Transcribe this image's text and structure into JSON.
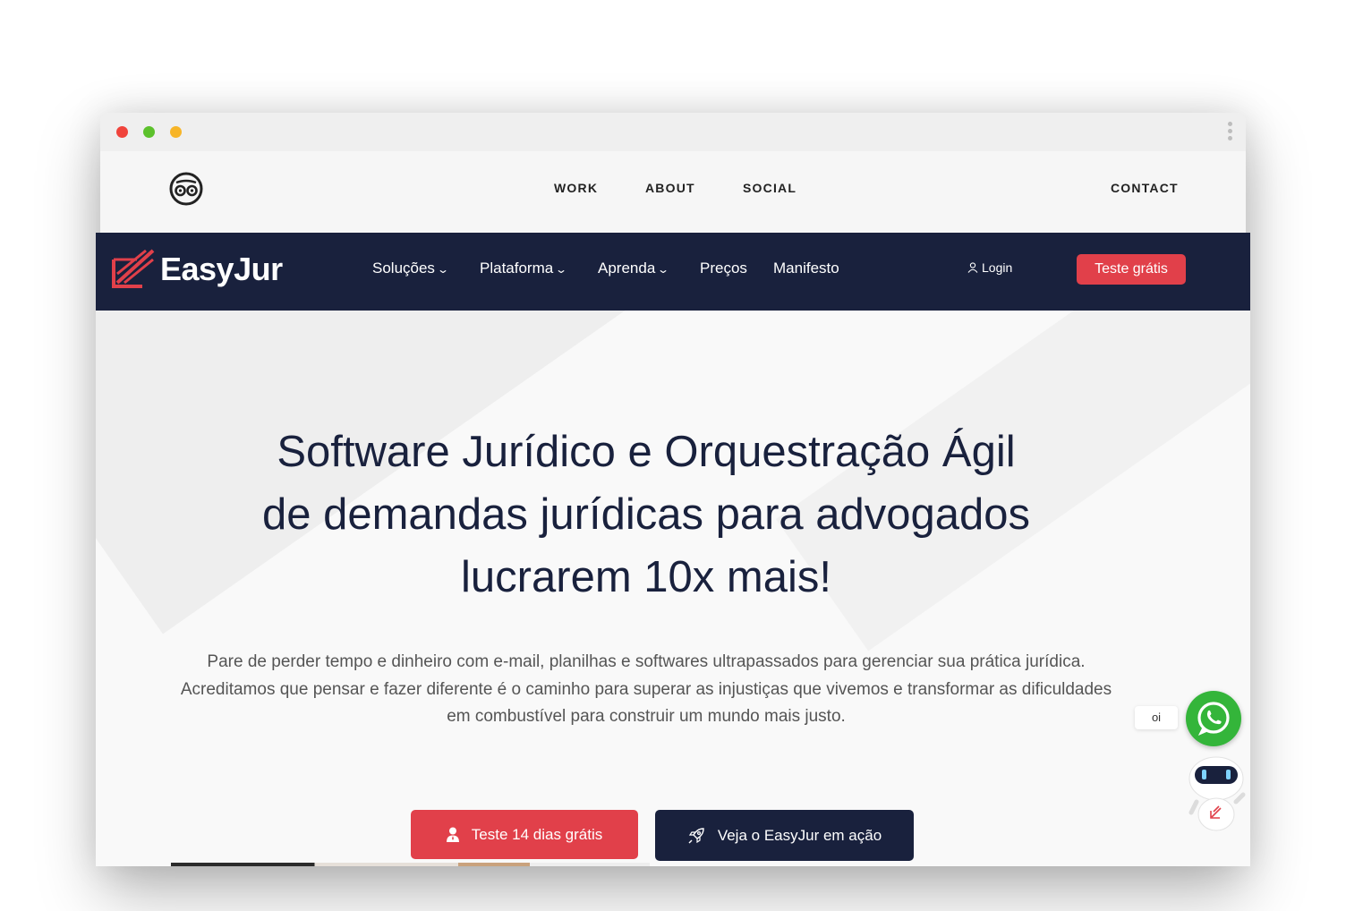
{
  "portfolio_nav": {
    "links": [
      "WORK",
      "ABOUT",
      "SOCIAL"
    ],
    "contact": "CONTACT"
  },
  "site": {
    "brand": "EasyJur",
    "menu": [
      {
        "label": "Soluções",
        "has_dropdown": true
      },
      {
        "label": "Plataforma",
        "has_dropdown": true
      },
      {
        "label": "Aprenda",
        "has_dropdown": true
      },
      {
        "label": "Preços",
        "has_dropdown": false
      },
      {
        "label": "Manifesto",
        "has_dropdown": false
      }
    ],
    "login": "Login",
    "header_cta": "Teste grátis"
  },
  "hero": {
    "title_lines": [
      "Software Jurídico e Orquestração Ágil",
      "de demandas jurídicas para advogados",
      "lucrarem 10x mais!"
    ],
    "subtitle_lines": [
      "Pare de perder tempo e dinheiro com e-mail, planilhas e softwares ultrapassados para gerenciar sua prática jurídica.",
      "Acreditamos que pensar e fazer diferente é o caminho para superar as injustiças que vivemos e transformar as dificuldades em combustível para construir um mundo mais justo."
    ],
    "primary_button": "Teste 14 dias grátis",
    "secondary_button": "Veja o EasyJur em ação"
  },
  "chat": {
    "whatsapp_label": "oi"
  },
  "colors": {
    "navy": "#19213d",
    "brand_red": "#e1404a",
    "whatsapp_green": "#34b53a"
  },
  "icons": [
    "owl-logo-icon",
    "easyjur-logo-icon",
    "chevron-down-icon",
    "user-icon",
    "user-icon-solid",
    "rocket-icon",
    "whatsapp-icon",
    "robot-icon"
  ]
}
